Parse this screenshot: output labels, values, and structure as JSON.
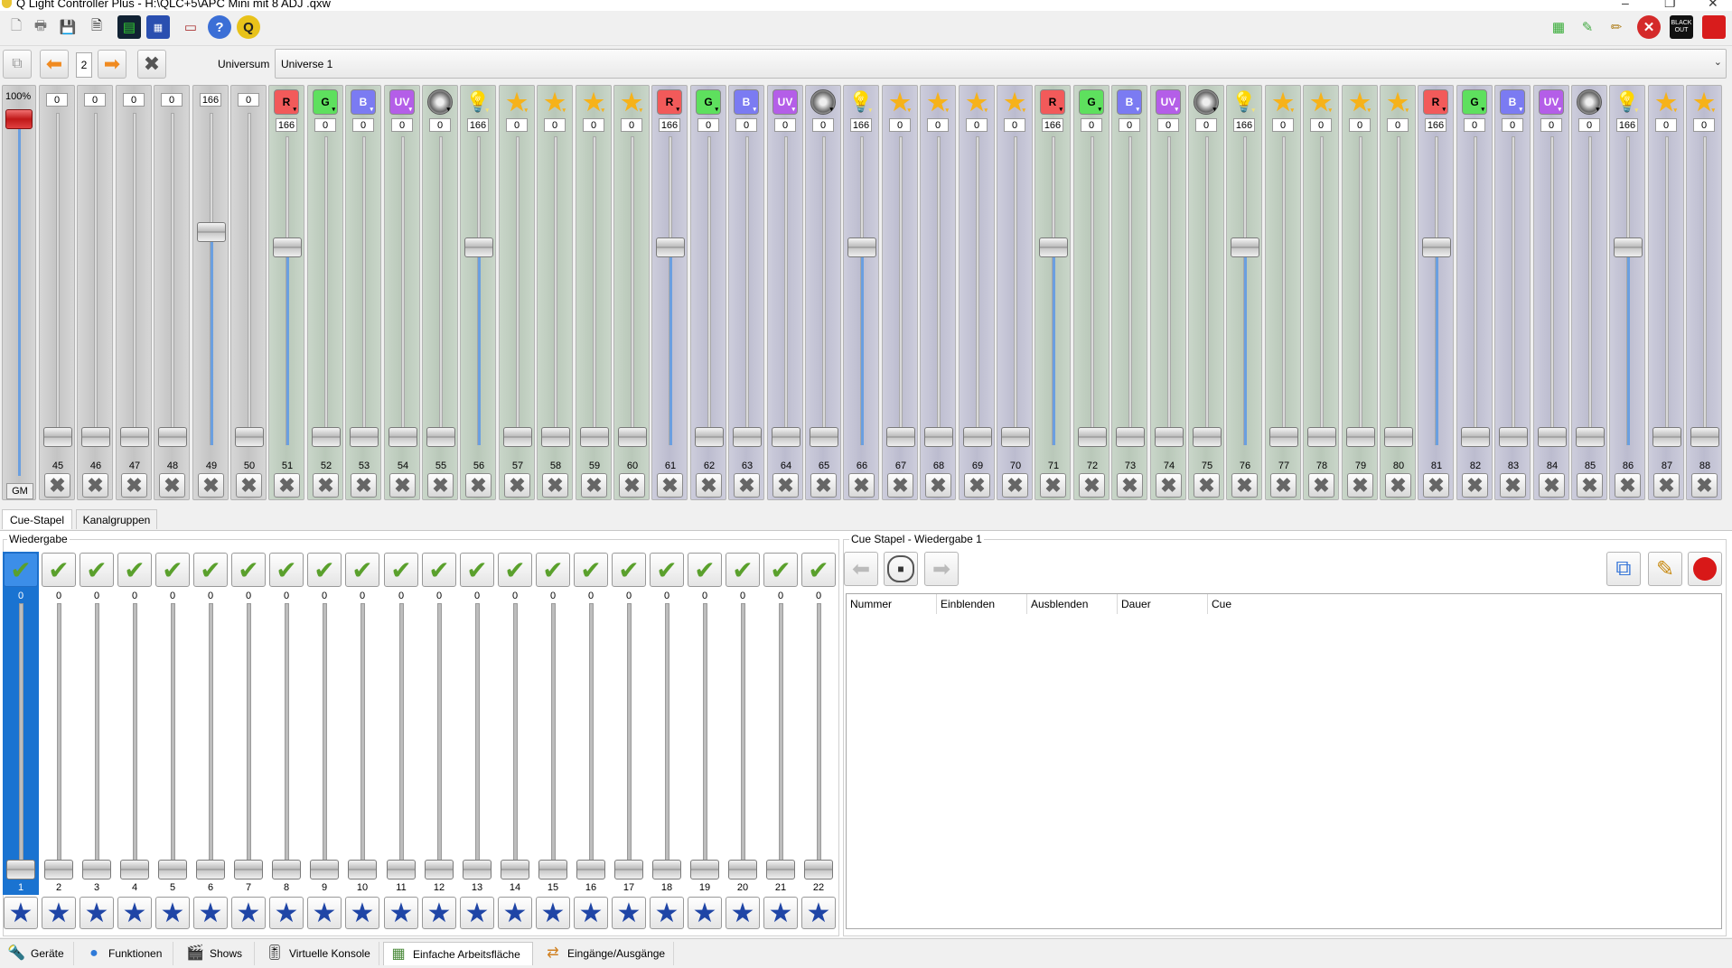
{
  "window": {
    "title": "Q Light Controller Plus - H:\\QLC+5\\APC Mini mit 8 ADJ .qxw"
  },
  "toolbar": {
    "left": [
      {
        "name": "new-workspace",
        "icon": "new-file-icon"
      },
      {
        "name": "open-workspace",
        "icon": "open-icon"
      },
      {
        "name": "save-workspace",
        "icon": "save-icon"
      },
      {
        "name": "save-as",
        "icon": "save-as-icon"
      },
      {
        "name": "monitor",
        "icon": "monitor-icon"
      },
      {
        "name": "address-tool",
        "icon": "dmx-grid-icon"
      },
      {
        "name": "dump-dmx",
        "icon": "image-icon"
      },
      {
        "name": "help",
        "icon": "help-icon"
      },
      {
        "name": "about",
        "icon": "qlc-logo-icon"
      }
    ],
    "right": [
      {
        "name": "fixture-mode",
        "icon": "palette-icon"
      },
      {
        "name": "edit-mode",
        "icon": "design-icon"
      },
      {
        "name": "operate-mode",
        "icon": "pencil-icon"
      },
      {
        "name": "stop-all",
        "icon": "stop-red-icon"
      },
      {
        "name": "blackout",
        "icon": "blackout-icon",
        "label": "BLACK OUT"
      },
      {
        "name": "power",
        "icon": "red-square-icon"
      }
    ]
  },
  "universe_bar": {
    "page_number": "2",
    "universe_label": "Universum",
    "universe_value": "Universe 1"
  },
  "grandmaster": {
    "percent": "100%",
    "label": "GM",
    "level": 1.0
  },
  "channels": [
    {
      "n": "45",
      "v": "0",
      "icon": "none",
      "bg": "gray"
    },
    {
      "n": "46",
      "v": "0",
      "icon": "none",
      "bg": "gray"
    },
    {
      "n": "47",
      "v": "0",
      "icon": "none",
      "bg": "gray"
    },
    {
      "n": "48",
      "v": "0",
      "icon": "none",
      "bg": "gray"
    },
    {
      "n": "49",
      "v": "166",
      "icon": "none",
      "bg": "gray"
    },
    {
      "n": "50",
      "v": "0",
      "icon": "none",
      "bg": "gray"
    },
    {
      "n": "51",
      "v": "166",
      "icon": "R",
      "bg": "green"
    },
    {
      "n": "52",
      "v": "0",
      "icon": "G",
      "bg": "green"
    },
    {
      "n": "53",
      "v": "0",
      "icon": "B",
      "bg": "green"
    },
    {
      "n": "54",
      "v": "0",
      "icon": "UV",
      "bg": "green"
    },
    {
      "n": "55",
      "v": "0",
      "icon": "shutter",
      "bg": "green"
    },
    {
      "n": "56",
      "v": "166",
      "icon": "bulb",
      "bg": "green"
    },
    {
      "n": "57",
      "v": "0",
      "icon": "star",
      "bg": "green"
    },
    {
      "n": "58",
      "v": "0",
      "icon": "star",
      "bg": "green"
    },
    {
      "n": "59",
      "v": "0",
      "icon": "star",
      "bg": "green"
    },
    {
      "n": "60",
      "v": "0",
      "icon": "star",
      "bg": "green"
    },
    {
      "n": "61",
      "v": "166",
      "icon": "R",
      "bg": "purple"
    },
    {
      "n": "62",
      "v": "0",
      "icon": "G",
      "bg": "purple"
    },
    {
      "n": "63",
      "v": "0",
      "icon": "B",
      "bg": "purple"
    },
    {
      "n": "64",
      "v": "0",
      "icon": "UV",
      "bg": "purple"
    },
    {
      "n": "65",
      "v": "0",
      "icon": "shutter",
      "bg": "purple"
    },
    {
      "n": "66",
      "v": "166",
      "icon": "bulb",
      "bg": "purple"
    },
    {
      "n": "67",
      "v": "0",
      "icon": "star",
      "bg": "purple"
    },
    {
      "n": "68",
      "v": "0",
      "icon": "star",
      "bg": "purple"
    },
    {
      "n": "69",
      "v": "0",
      "icon": "star",
      "bg": "purple"
    },
    {
      "n": "70",
      "v": "0",
      "icon": "star",
      "bg": "purple"
    },
    {
      "n": "71",
      "v": "166",
      "icon": "R",
      "bg": "green"
    },
    {
      "n": "72",
      "v": "0",
      "icon": "G",
      "bg": "green"
    },
    {
      "n": "73",
      "v": "0",
      "icon": "B",
      "bg": "green"
    },
    {
      "n": "74",
      "v": "0",
      "icon": "UV",
      "bg": "green"
    },
    {
      "n": "75",
      "v": "0",
      "icon": "shutter",
      "bg": "green"
    },
    {
      "n": "76",
      "v": "166",
      "icon": "bulb",
      "bg": "green"
    },
    {
      "n": "77",
      "v": "0",
      "icon": "star",
      "bg": "green"
    },
    {
      "n": "78",
      "v": "0",
      "icon": "star",
      "bg": "green"
    },
    {
      "n": "79",
      "v": "0",
      "icon": "star",
      "bg": "green"
    },
    {
      "n": "80",
      "v": "0",
      "icon": "star",
      "bg": "green"
    },
    {
      "n": "81",
      "v": "166",
      "icon": "R",
      "bg": "purple"
    },
    {
      "n": "82",
      "v": "0",
      "icon": "G",
      "bg": "purple"
    },
    {
      "n": "83",
      "v": "0",
      "icon": "B",
      "bg": "purple"
    },
    {
      "n": "84",
      "v": "0",
      "icon": "UV",
      "bg": "purple"
    },
    {
      "n": "85",
      "v": "0",
      "icon": "shutter",
      "bg": "purple"
    },
    {
      "n": "86",
      "v": "166",
      "icon": "bulb",
      "bg": "purple"
    },
    {
      "n": "87",
      "v": "0",
      "icon": "star",
      "bg": "purple"
    },
    {
      "n": "88",
      "v": "0",
      "icon": "star",
      "bg": "purple"
    }
  ],
  "icon_colors": {
    "R": "#f25a5a",
    "G": "#5ee05e",
    "B": "#7b7bf2",
    "UV": "#b45ee8",
    "fill": "#6a9fe0"
  },
  "tabs": [
    {
      "label": "Cue-Stapel",
      "active": true
    },
    {
      "label": "Kanalgruppen",
      "active": false
    }
  ],
  "playback": {
    "group_label": "Wiedergabe",
    "selected_index": 0,
    "items": [
      {
        "n": "1",
        "v": "0"
      },
      {
        "n": "2",
        "v": "0"
      },
      {
        "n": "3",
        "v": "0"
      },
      {
        "n": "4",
        "v": "0"
      },
      {
        "n": "5",
        "v": "0"
      },
      {
        "n": "6",
        "v": "0"
      },
      {
        "n": "7",
        "v": "0"
      },
      {
        "n": "8",
        "v": "0"
      },
      {
        "n": "9",
        "v": "0"
      },
      {
        "n": "10",
        "v": "0"
      },
      {
        "n": "11",
        "v": "0"
      },
      {
        "n": "12",
        "v": "0"
      },
      {
        "n": "13",
        "v": "0"
      },
      {
        "n": "14",
        "v": "0"
      },
      {
        "n": "15",
        "v": "0"
      },
      {
        "n": "16",
        "v": "0"
      },
      {
        "n": "17",
        "v": "0"
      },
      {
        "n": "18",
        "v": "0"
      },
      {
        "n": "19",
        "v": "0"
      },
      {
        "n": "20",
        "v": "0"
      },
      {
        "n": "21",
        "v": "0"
      },
      {
        "n": "22",
        "v": "0"
      }
    ]
  },
  "cue_stack": {
    "title": "Cue Stapel - Wiedergabe 1",
    "columns": [
      "Nummer",
      "Einblenden",
      "Ausblenden",
      "Dauer",
      "Cue"
    ]
  },
  "bottom_tabs": [
    {
      "label": "Geräte",
      "icon": "fixtures-icon",
      "active": false
    },
    {
      "label": "Funktionen",
      "icon": "functions-icon",
      "active": false
    },
    {
      "label": "Shows",
      "icon": "shows-icon",
      "active": false
    },
    {
      "label": "Virtuelle Konsole",
      "icon": "virtual-console-icon",
      "active": false
    },
    {
      "label": "Einfache Arbeitsfläche",
      "icon": "simple-desk-icon",
      "active": true
    },
    {
      "label": "Eingänge/Ausgänge",
      "icon": "inputs-outputs-icon",
      "active": false
    }
  ]
}
